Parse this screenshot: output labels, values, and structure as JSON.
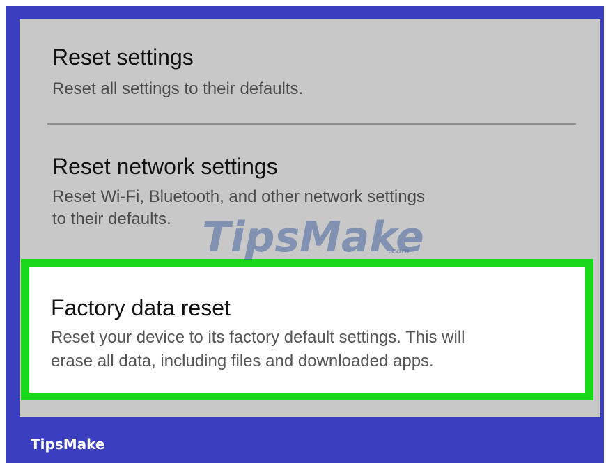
{
  "settings": {
    "items": [
      {
        "title": "Reset settings",
        "subtitle_lines": [
          "Reset all settings to their defaults."
        ]
      },
      {
        "title": "Reset network settings",
        "subtitle_lines": [
          "Reset Wi-Fi, Bluetooth, and other network settings",
          "to their defaults."
        ]
      },
      {
        "title": "Factory data reset",
        "subtitle_lines": [
          "Reset your device to its factory default settings. This will",
          "erase all data, including files and downloaded apps."
        ],
        "highlighted": true
      }
    ]
  },
  "watermark": {
    "text": "TipsMake",
    "suffix": ".com"
  },
  "brand": "TipsMake",
  "colors": {
    "frame": "#3b3fbf",
    "screen": "#c8c8c8",
    "highlight_border": "#19d719"
  }
}
